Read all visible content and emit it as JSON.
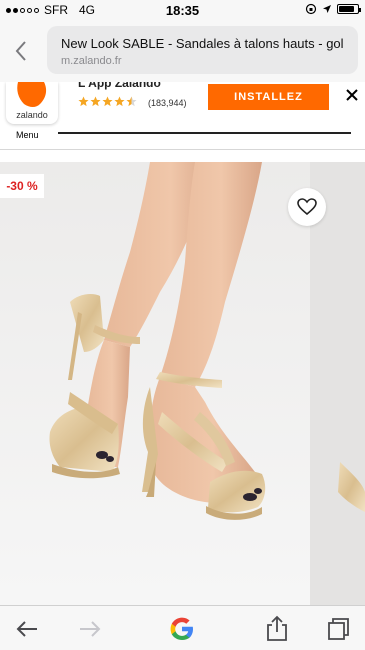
{
  "status_bar": {
    "carrier": "SFR",
    "network": "4G",
    "time": "18:35",
    "battery_level": 0.85
  },
  "browser": {
    "page_title": "New Look SABLE - Sandales à talons hauts - gold -",
    "host": "m.zalando.fr"
  },
  "app_banner": {
    "logo_text": "zalando",
    "app_name": "L'App Zalando",
    "rating": 4.5,
    "rating_count": "(183,944)",
    "install_label": "INSTALLEZ",
    "brand_color": "#ff6900",
    "star_color": "#f5a623"
  },
  "nav": {
    "menu_label": "Menu"
  },
  "product": {
    "discount_badge": "-30 %",
    "discount_color": "#dd2222"
  },
  "icons": [
    "chevron-left-icon",
    "close-icon",
    "star-icon",
    "heart-icon",
    "arrow-left-icon",
    "arrow-right-icon",
    "google-icon",
    "share-icon",
    "tabs-icon"
  ]
}
